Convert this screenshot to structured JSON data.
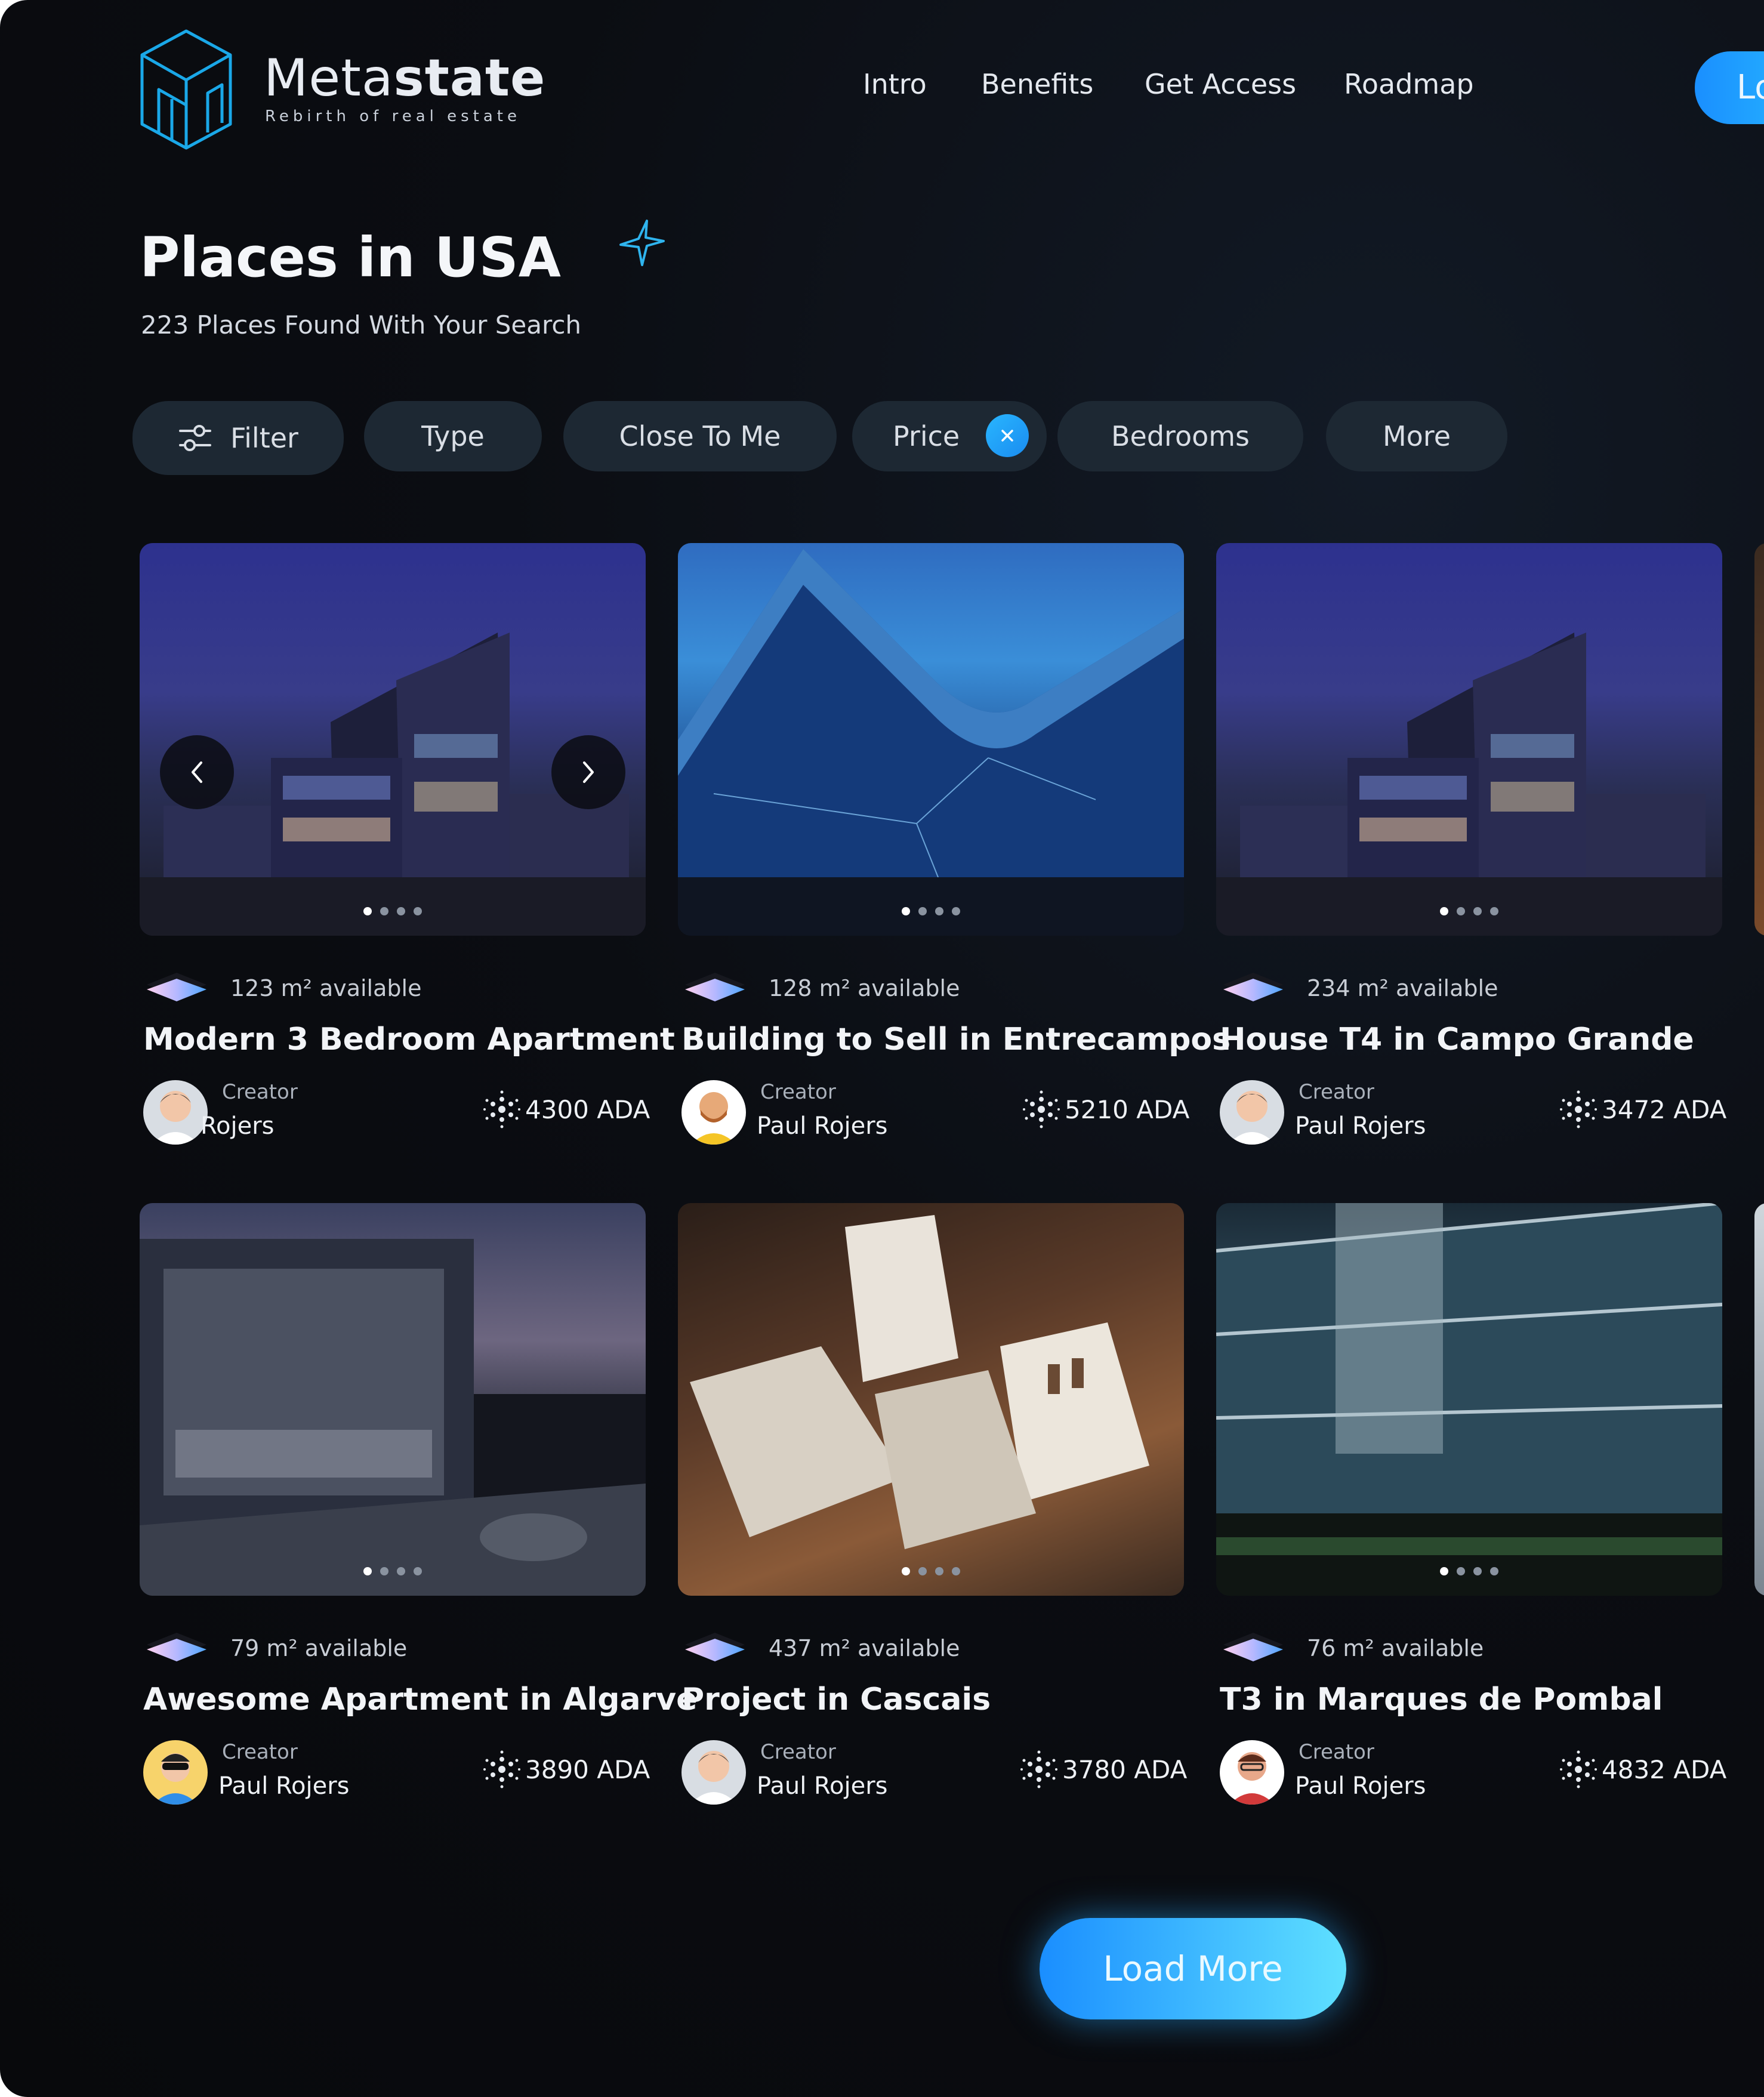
{
  "brand": {
    "name_light": "Meta",
    "name_bold": "state",
    "tagline": "Rebirth of real estate"
  },
  "nav": {
    "items": [
      "Intro",
      "Benefits",
      "Get Access",
      "Roadmap"
    ],
    "login_label": "Lo"
  },
  "page": {
    "title": "Places in USA",
    "results": "223 Places Found With Your Search"
  },
  "filters": {
    "filter": "Filter",
    "type": "Type",
    "close_to_me": "Close To Me",
    "price": "Price",
    "bedrooms": "Bedrooms",
    "more": "More"
  },
  "cards": [
    {
      "area": "123 m² available",
      "title": "Modern 3 Bedroom Apartment",
      "creator_label": "Creator",
      "creator": "Rojers",
      "price": "4300 ADA"
    },
    {
      "area": "128 m² available",
      "title": "Building to Sell in Entrecampos",
      "creator_label": "Creator",
      "creator": "Paul Rojers",
      "price": "5210 ADA"
    },
    {
      "area": "234 m² available",
      "title": "House T4 in Campo Grande",
      "creator_label": "Creator",
      "creator": "Paul Rojers",
      "price": "3472 ADA"
    },
    {
      "area": "79 m² available",
      "title": "Awesome Apartment in Algarve",
      "creator_label": "Creator",
      "creator": "Paul Rojers",
      "price": "3890 ADA"
    },
    {
      "area": "437 m² available",
      "title": "Project in Cascais",
      "creator_label": "Creator",
      "creator": "Paul Rojers",
      "price": "3780 ADA"
    },
    {
      "area": "76 m² available",
      "title": "T3 in Marques de Pombal",
      "creator_label": "Creator",
      "creator": "Paul Rojers",
      "price": "4832 ADA"
    }
  ],
  "load_more": "Load More",
  "colors": {
    "accent": "#1a8eff",
    "accent_light": "#5fe0ff",
    "background": "#0b0c10",
    "chip": "#1d2833"
  }
}
